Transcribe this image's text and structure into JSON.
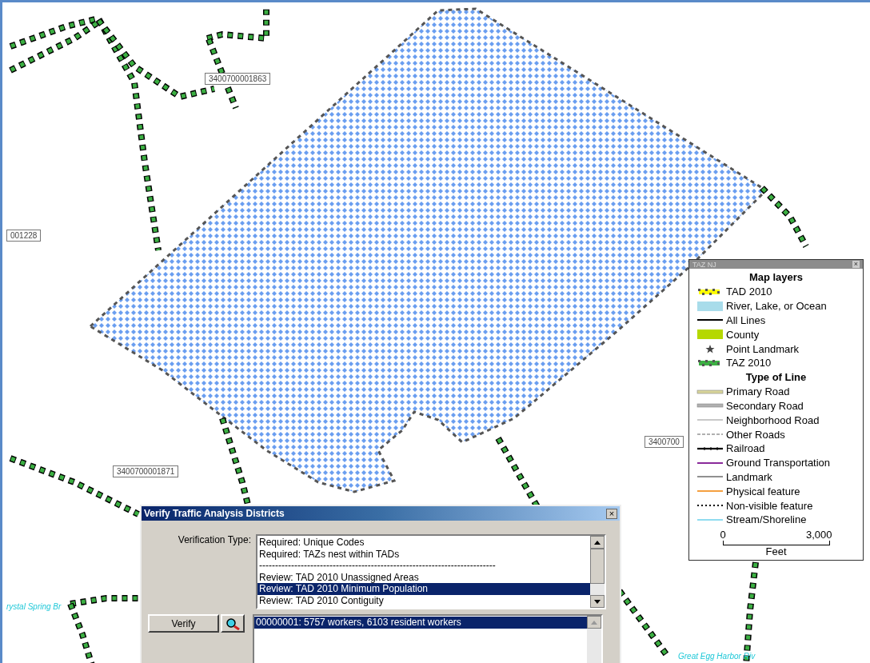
{
  "map": {
    "labels": [
      {
        "text": "3400700001863",
        "kind": "id"
      },
      {
        "text": "001228",
        "kind": "id"
      },
      {
        "text": "3400700001871",
        "kind": "id"
      },
      {
        "text": "3400700",
        "kind": "id"
      },
      {
        "text": "rystal Spring Br",
        "kind": "stream"
      },
      {
        "text": "Great Egg Harbor Riv",
        "kind": "stream"
      }
    ]
  },
  "legend": {
    "title": "TAZ NJ",
    "close": "×",
    "heading": "Map layers",
    "items": [
      {
        "label": "TAD 2010",
        "kind": "dots",
        "color": "#ffff00"
      },
      {
        "label": "River, Lake, or Ocean",
        "kind": "fill",
        "color": "#a8dcea"
      },
      {
        "label": "All Lines",
        "kind": "line",
        "color": "#000000"
      },
      {
        "label": "County",
        "kind": "fill",
        "color": "#b5d800"
      },
      {
        "label": "Point Landmark",
        "kind": "star",
        "color": "#444444"
      },
      {
        "label": "TAZ 2010",
        "kind": "dots",
        "color": "#3cb043"
      },
      {
        "label": "Type of Line",
        "kind": "heading"
      },
      {
        "label": "Primary Road",
        "kind": "double",
        "color": "#d8d49a"
      },
      {
        "label": "Secondary Road",
        "kind": "double",
        "color": "#b0b0b0"
      },
      {
        "label": "Neighborhood Road",
        "kind": "line",
        "color": "#c8c8c8"
      },
      {
        "label": "Other Roads",
        "kind": "dashed",
        "color": "#b0b0b0"
      },
      {
        "label": "Railroad",
        "kind": "rail",
        "color": "#000000"
      },
      {
        "label": "Ground Transportation",
        "kind": "line",
        "color": "#8a2a9a"
      },
      {
        "label": "Landmark",
        "kind": "line",
        "color": "#909090"
      },
      {
        "label": "Physical feature",
        "kind": "line",
        "color": "#f5a040"
      },
      {
        "label": "Non-visible feature",
        "kind": "dotted",
        "color": "#000000"
      },
      {
        "label": "Stream/Shoreline",
        "kind": "line",
        "color": "#90dcf0"
      }
    ],
    "scale": {
      "start": "0",
      "end": "3,000",
      "unit": "Feet"
    }
  },
  "dialog": {
    "title": "Verify Traffic Analysis Districts",
    "close": "×",
    "type_label": "Verification Type:",
    "types": [
      {
        "text": "Required: Unique Codes",
        "selected": false
      },
      {
        "text": "Required: TAZs nest within TADs",
        "selected": false
      },
      {
        "text": "--------------------------------------------------------------------------",
        "selected": false
      },
      {
        "text": "Review: TAD 2010 Unassigned Areas",
        "selected": false
      },
      {
        "text": "Review: TAD 2010 Minimum Population",
        "selected": true
      },
      {
        "text": "Review: TAD 2010 Contiguity",
        "selected": false
      }
    ],
    "verify_button": "Verify",
    "results": [
      {
        "text": "00000001: 5757 workers, 6103 resident workers",
        "selected": true
      }
    ]
  }
}
